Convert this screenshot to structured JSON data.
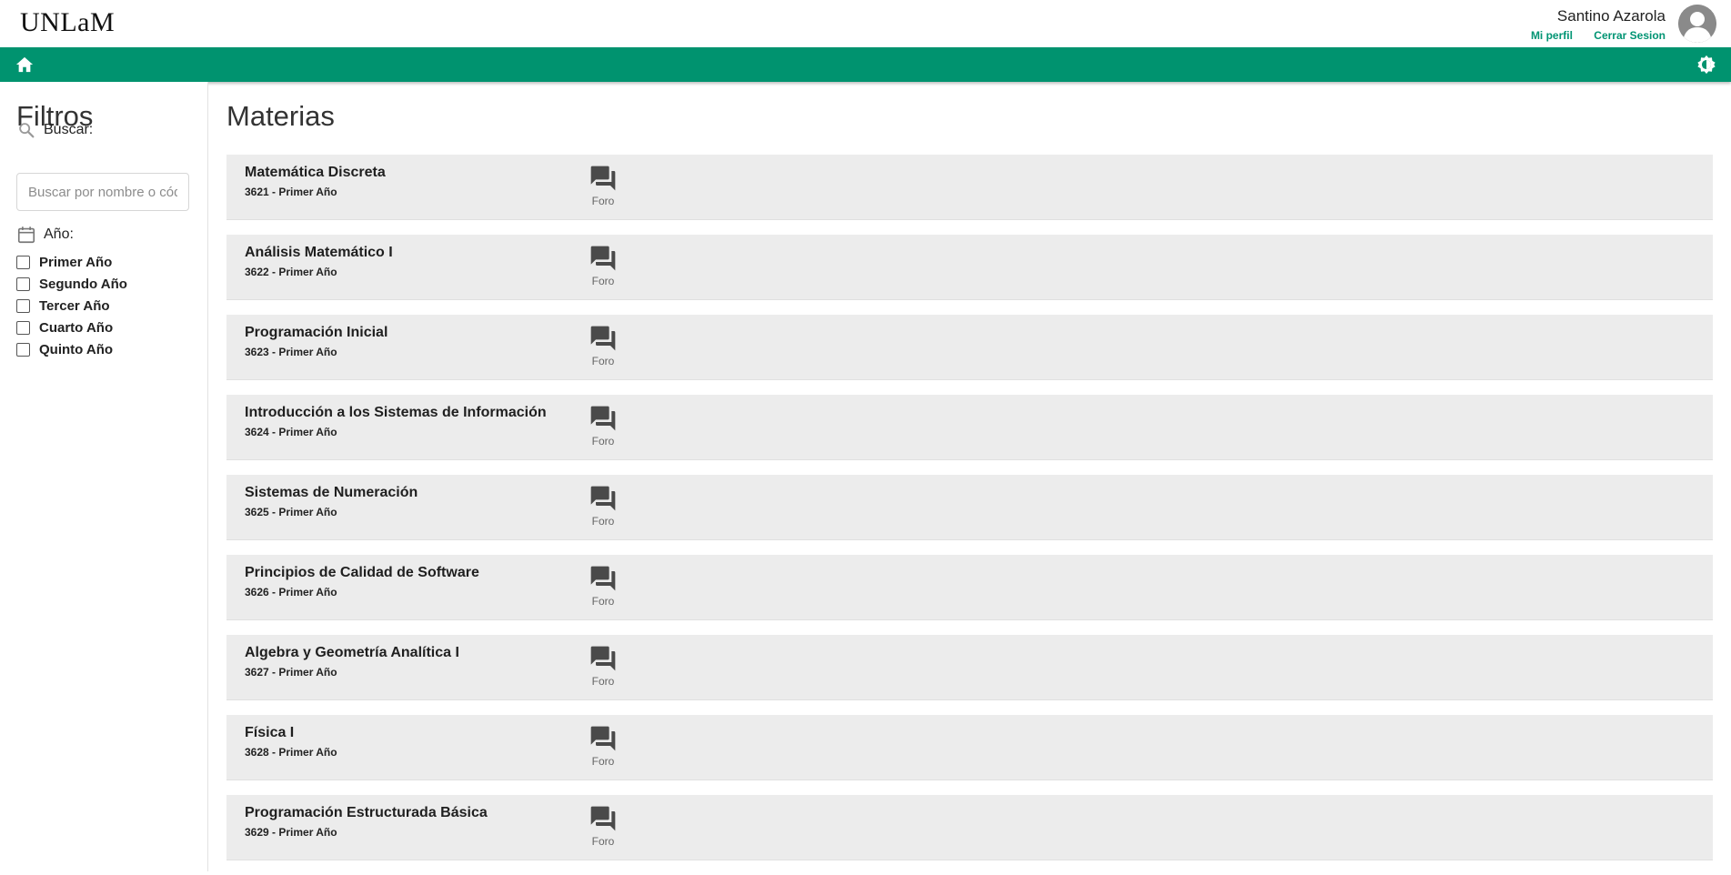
{
  "header": {
    "logo": "UNLaM",
    "user_name": "Santino Azarola",
    "profile_link": "Mi perfil",
    "logout_link": "Cerrar Sesion"
  },
  "colors": {
    "accent": "#00936f",
    "card_bg": "#ececec"
  },
  "sidebar": {
    "title": "Filtros",
    "search_label": "Buscar:",
    "search_placeholder": "Buscar por nombre o código",
    "year_label": "Año:",
    "years": [
      "Primer Año",
      "Segundo Año",
      "Tercer Año",
      "Cuarto Año",
      "Quinto Año"
    ]
  },
  "main": {
    "title": "Materias",
    "forum_label": "Foro",
    "courses": [
      {
        "name": "Matemática Discreta",
        "sub": "3621 - Primer Año"
      },
      {
        "name": "Análisis Matemático I",
        "sub": "3622 - Primer Año"
      },
      {
        "name": "Programación Inicial",
        "sub": "3623 - Primer Año"
      },
      {
        "name": "Introducción a los Sistemas de Información",
        "sub": "3624 - Primer Año"
      },
      {
        "name": "Sistemas de Numeración",
        "sub": "3625 - Primer Año"
      },
      {
        "name": "Principios de Calidad de Software",
        "sub": "3626 - Primer Año"
      },
      {
        "name": "Algebra y Geometría Analítica I",
        "sub": "3627 - Primer Año"
      },
      {
        "name": "Física I",
        "sub": "3628 - Primer Año"
      },
      {
        "name": "Programación Estructurada Básica",
        "sub": "3629 - Primer Año"
      }
    ]
  }
}
